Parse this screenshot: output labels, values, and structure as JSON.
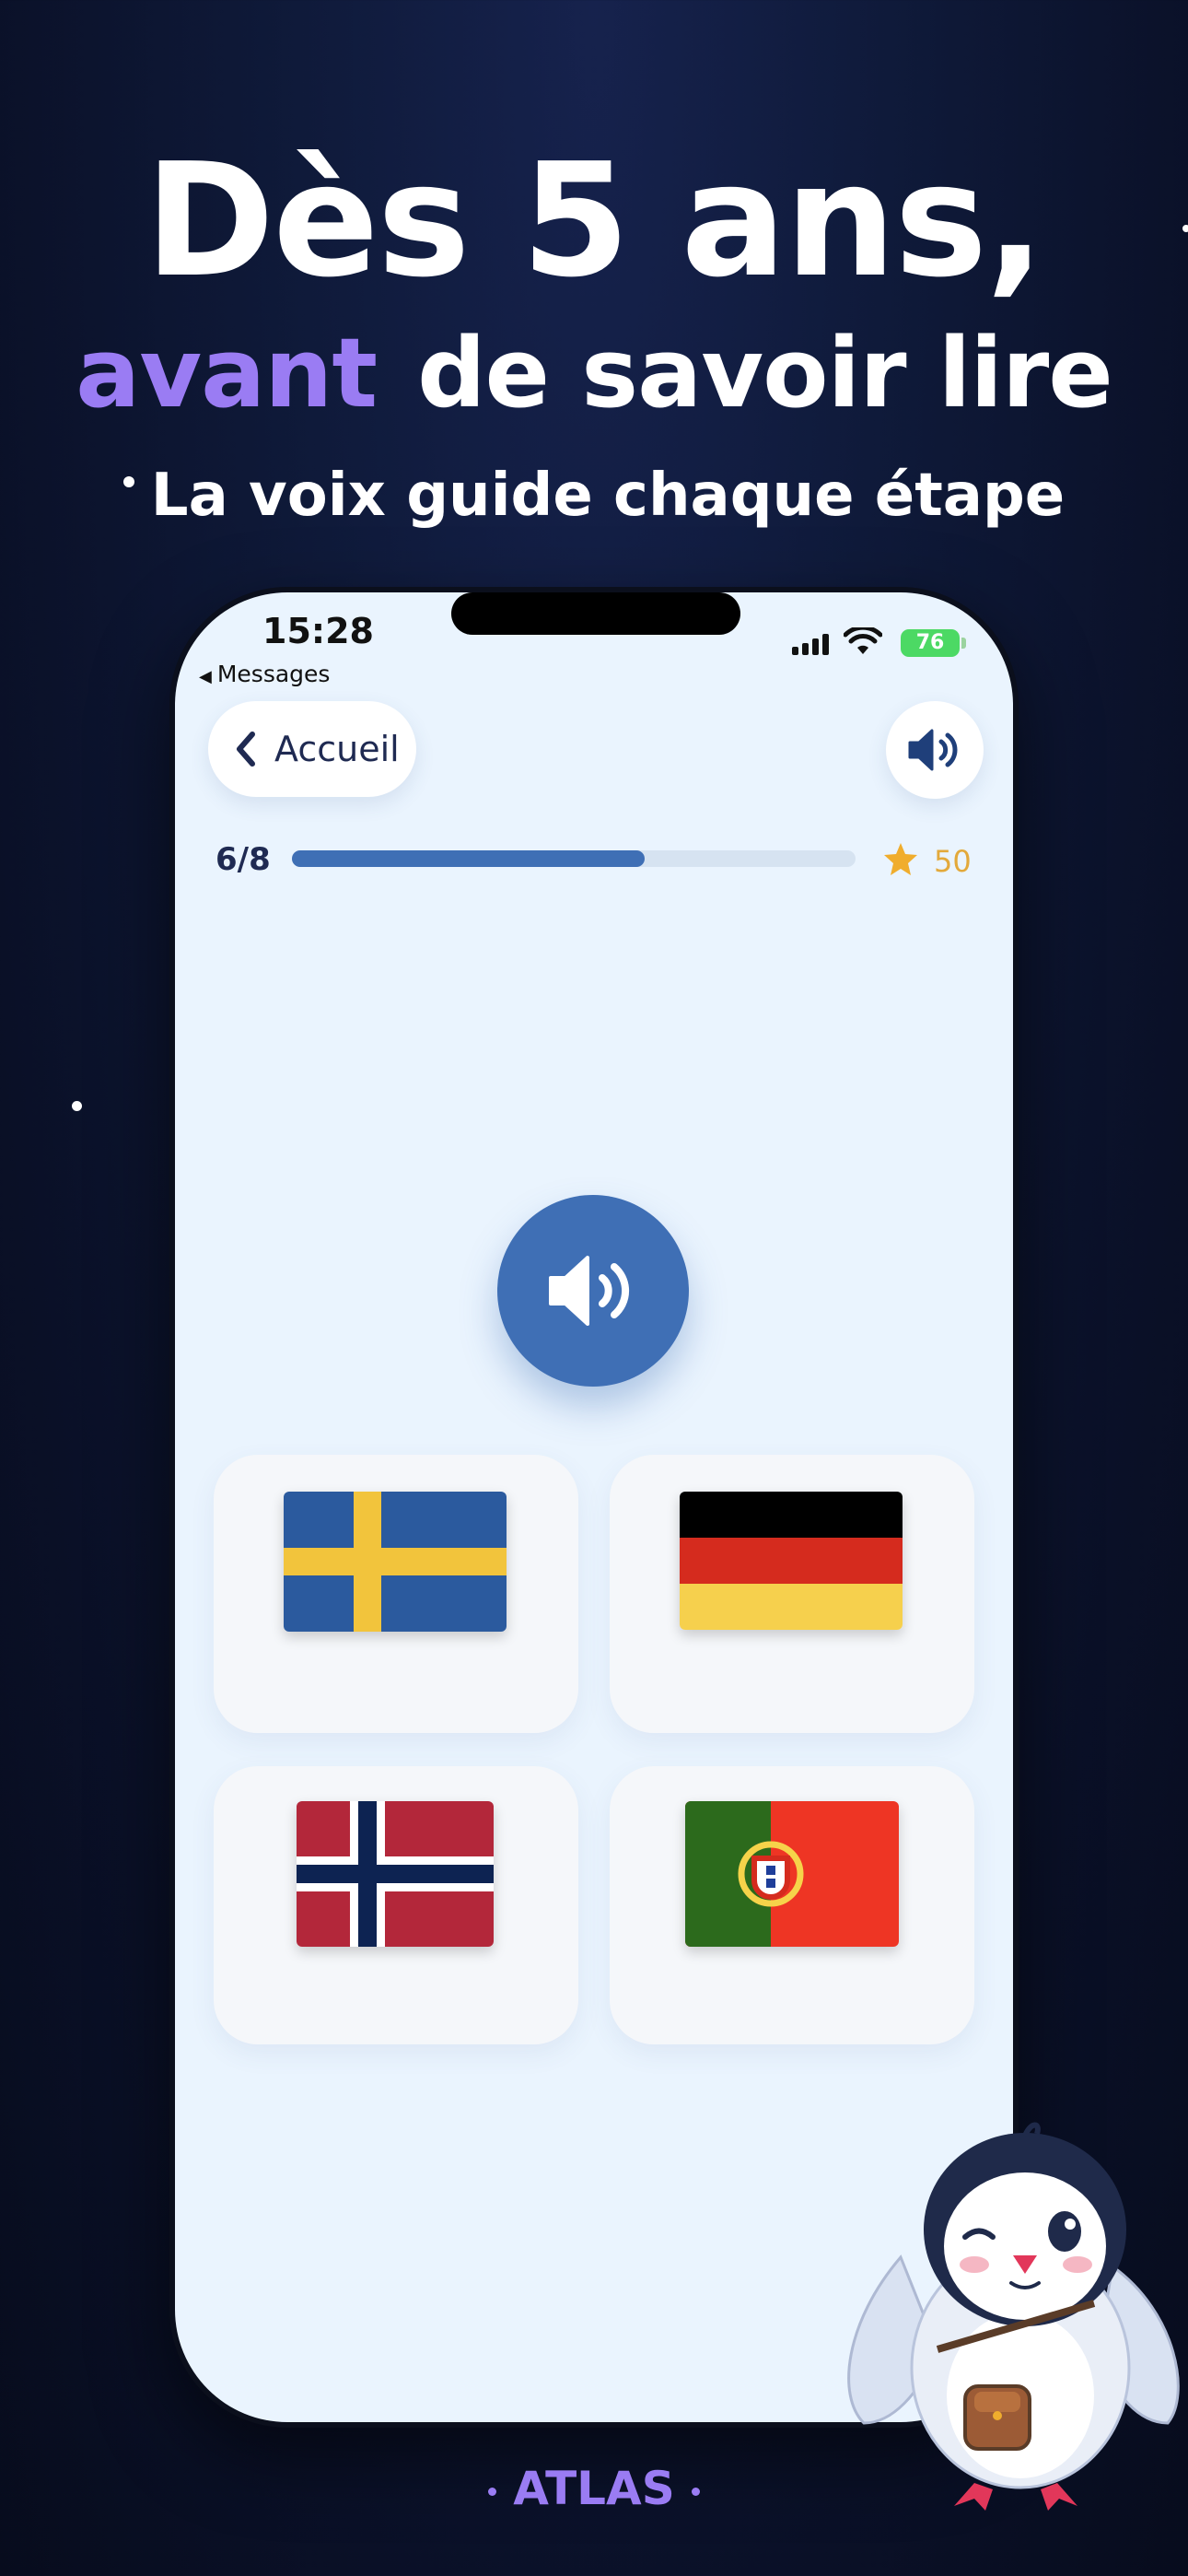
{
  "hero": {
    "title_line1": "Dès 5 ans,",
    "title_accent": "avant",
    "title_line2_rest": "de savoir lire",
    "subtitle": "La voix guide chaque étape"
  },
  "status_bar": {
    "time": "15:28",
    "back_app": "Messages",
    "battery": "76"
  },
  "nav": {
    "back_label": "Accueil",
    "sound_icon": "speaker-icon"
  },
  "progress": {
    "count_label": "6/8",
    "fraction": 0.625,
    "score": "50"
  },
  "question": {
    "play_icon": "speaker-icon"
  },
  "answers": [
    {
      "country": "Sweden"
    },
    {
      "country": "Germany"
    },
    {
      "country": "Norway"
    },
    {
      "country": "Portugal"
    }
  ],
  "colors": {
    "accent_purple": "#9a7cf3",
    "primary_blue": "#3f6fb5",
    "star_gold": "#e3a93b",
    "background_navy": "#0f1a3a",
    "screen_bg": "#eaf4fe"
  },
  "brand": {
    "name": "ATLAS"
  }
}
